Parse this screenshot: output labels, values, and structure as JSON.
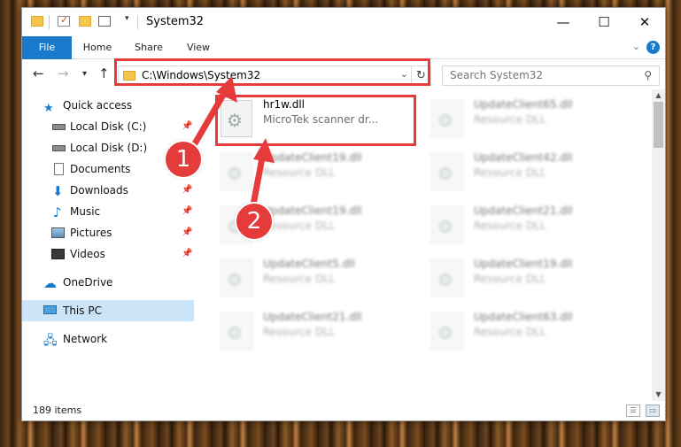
{
  "window": {
    "title": "System32",
    "controls": {
      "minimize": "—",
      "maximize": "☐",
      "close": "✕"
    }
  },
  "ribbon": {
    "tabs": [
      "File",
      "Home",
      "Share",
      "View"
    ],
    "help_label": "?"
  },
  "nav": {
    "back": "←",
    "forward": "→",
    "recent": "▾",
    "up": "↑",
    "address": "C:\\Windows\\System32",
    "address_dropdown": "⌄",
    "refresh": "↻",
    "search_placeholder": "Search System32"
  },
  "sidebar": {
    "items": [
      {
        "label": "Quick access",
        "icon": "star-icon",
        "pinned": false
      },
      {
        "label": "Local Disk (C:)",
        "icon": "drive-icon",
        "pinned": true
      },
      {
        "label": "Local Disk (D:)",
        "icon": "drive-icon",
        "pinned": false
      },
      {
        "label": "Documents",
        "icon": "documents-icon",
        "pinned": true
      },
      {
        "label": "Downloads",
        "icon": "download-icon",
        "pinned": true
      },
      {
        "label": "Music",
        "icon": "music-icon",
        "pinned": true
      },
      {
        "label": "Pictures",
        "icon": "pictures-icon",
        "pinned": true
      },
      {
        "label": "Videos",
        "icon": "videos-icon",
        "pinned": true
      },
      {
        "label": "OneDrive",
        "icon": "cloud-icon",
        "pinned": false
      },
      {
        "label": "This PC",
        "icon": "computer-icon",
        "pinned": false,
        "selected": true
      },
      {
        "label": "Network",
        "icon": "network-icon",
        "pinned": false
      }
    ],
    "pin_glyph": "📌"
  },
  "files": [
    {
      "name": "hr1w.dll",
      "desc": "MicroTek scanner dr..."
    },
    {
      "name": "UpdateClient65.dll",
      "desc": "Resource DLL"
    },
    {
      "name": "UpdateClient19.dll",
      "desc": "Resource DLL"
    },
    {
      "name": "UpdateClient42.dll",
      "desc": "Resource DLL"
    },
    {
      "name": "UpdateClient19.dll",
      "desc": "Resource DLL"
    },
    {
      "name": "UpdateClient21.dll",
      "desc": "Resource DLL"
    },
    {
      "name": "UpdateClient5.dll",
      "desc": "Resource DLL"
    },
    {
      "name": "UpdateClient19.dll",
      "desc": "Resource DLL"
    },
    {
      "name": "UpdateClient21.dll",
      "desc": "Resource DLL"
    },
    {
      "name": "UpdateClient63.dll",
      "desc": "Resource DLL"
    }
  ],
  "status": {
    "item_count": "189 items"
  },
  "annotations": {
    "step1": "1",
    "step2": "2",
    "color": "#e53b3b"
  }
}
